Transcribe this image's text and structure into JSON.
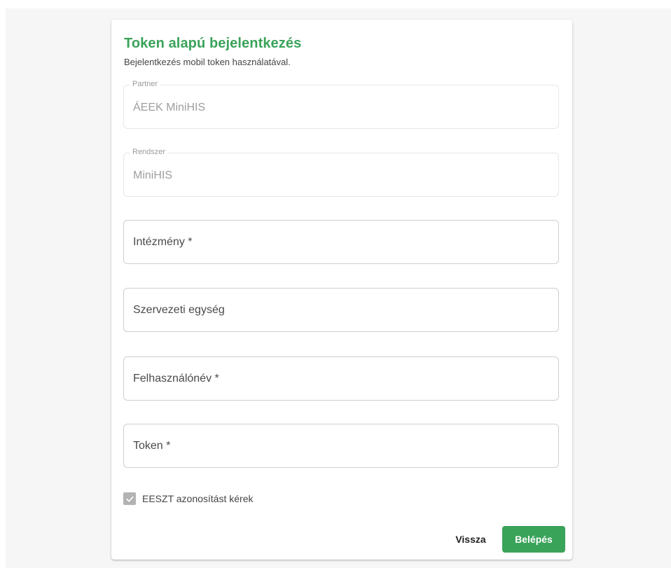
{
  "header": {
    "title": "Token alapú bejelentkezés",
    "subtitle": "Bejelentkezés mobil token használatával."
  },
  "fields": {
    "partner": {
      "label": "Partner",
      "value": "ÁEEK MiniHIS"
    },
    "system": {
      "label": "Rendszer",
      "value": "MiniHIS"
    },
    "institution": {
      "placeholder": "Intézmény *",
      "value": ""
    },
    "unit": {
      "placeholder": "Szervezeti egység",
      "value": ""
    },
    "username": {
      "placeholder": "Felhasználónév *",
      "value": ""
    },
    "token": {
      "placeholder": "Token *",
      "value": ""
    }
  },
  "eeszt": {
    "label": "EESZT azonosítást kérek",
    "checked": true,
    "icon": "check-icon"
  },
  "actions": {
    "back_label": "Vissza",
    "login_label": "Belépés"
  },
  "colors": {
    "accent": "#3aa35a",
    "checkbox": "#b3b3b3"
  }
}
